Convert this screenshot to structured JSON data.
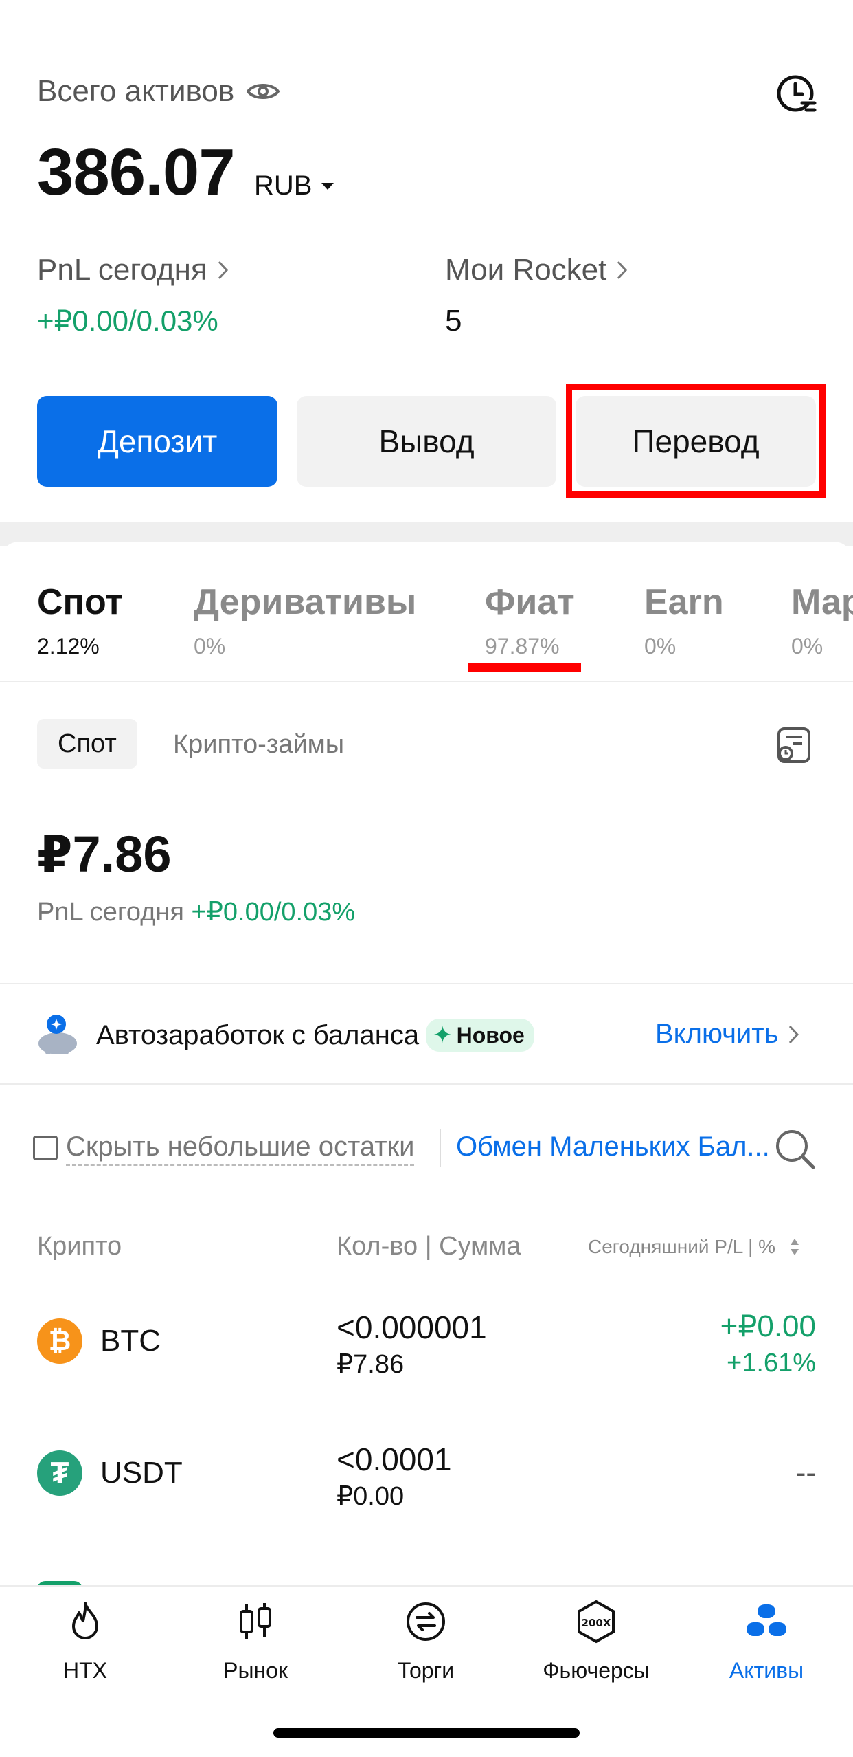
{
  "header": {
    "total_label": "Всего активов",
    "total_value": "386.07",
    "currency": "RUB",
    "pnl_label": "PnL сегодня",
    "pnl_value": "+₽0.00/0.03%",
    "rocket_label": "Мои Rocket",
    "rocket_value": "5"
  },
  "actions": {
    "deposit": "Депозит",
    "withdraw": "Вывод",
    "transfer": "Перевод"
  },
  "tabs": [
    {
      "label": "Спот",
      "sub": "2.12%"
    },
    {
      "label": "Деривативы",
      "sub": "0%"
    },
    {
      "label": "Фиат",
      "sub": "97.87%"
    },
    {
      "label": "Earn",
      "sub": "0%"
    },
    {
      "label": "Мар",
      "sub": "0%"
    }
  ],
  "subtabs": {
    "spot": "Спот",
    "crypto_loans": "Крипто-займы"
  },
  "spot": {
    "balance": "₽7.86",
    "pnl_label": "PnL сегодня",
    "pnl_value": "+₽0.00/0.03%"
  },
  "earn_banner": {
    "text": "Автозаработок с баланса",
    "badge": "Новое",
    "link": "Включить"
  },
  "filters": {
    "hide_small": "Скрыть небольшие остатки",
    "exchange_small": "Обмен Маленьких Бал..."
  },
  "table": {
    "col_crypto": "Крипто",
    "col_qty": "Кол-во | Сумма",
    "col_pl": "Сегодняшний P/L | %",
    "rows": [
      {
        "coin": "BTC",
        "qty": "<0.000001",
        "amount": "₽7.86",
        "pl": "+₽0.00",
        "pl_pct": "+1.61%",
        "color": "#f7931a"
      },
      {
        "coin": "USDT",
        "qty": "<0.0001",
        "amount": "₽0.00",
        "pl": "--",
        "pl_pct": "",
        "color": "#26a17b"
      }
    ]
  },
  "nav": {
    "items": [
      {
        "label": "HTX",
        "icon": "flame-icon"
      },
      {
        "label": "Рынок",
        "icon": "candlestick-icon"
      },
      {
        "label": "Торги",
        "icon": "swap-icon"
      },
      {
        "label": "Фьючерсы",
        "icon": "futures-200x-icon"
      },
      {
        "label": "Активы",
        "icon": "assets-icon"
      }
    ],
    "active_color": "#0a6fe8"
  }
}
